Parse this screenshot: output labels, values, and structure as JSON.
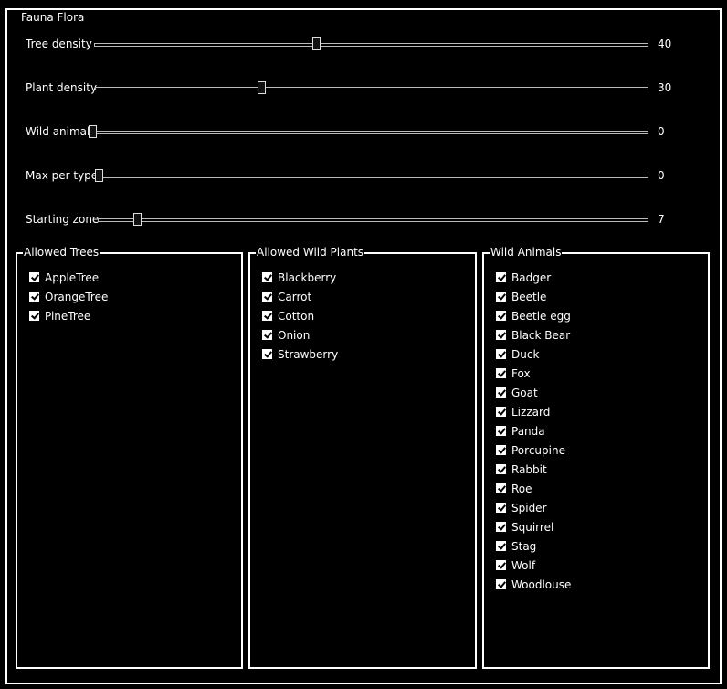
{
  "tabs": [
    "Fauna",
    "Flora"
  ],
  "tabs_label": "Fauna  Flora",
  "sliders": [
    {
      "label": "Tree density",
      "value": 40,
      "min": 0,
      "max": 100
    },
    {
      "label": "Plant density",
      "value": 30,
      "min": 0,
      "max": 100
    },
    {
      "label": "Wild animals",
      "value": 0,
      "min": 0,
      "max": 100
    },
    {
      "label": "Max per type",
      "value": 0,
      "min": 0,
      "max": 100
    },
    {
      "label": "Starting zone",
      "value": 7,
      "min": 0,
      "max": 100
    }
  ],
  "groups": [
    {
      "title": "Allowed Trees",
      "items": [
        {
          "label": "AppleTree",
          "checked": true
        },
        {
          "label": "OrangeTree",
          "checked": true
        },
        {
          "label": "PineTree",
          "checked": true
        }
      ]
    },
    {
      "title": "Allowed Wild Plants",
      "items": [
        {
          "label": "Blackberry",
          "checked": true
        },
        {
          "label": "Carrot",
          "checked": true
        },
        {
          "label": "Cotton",
          "checked": true
        },
        {
          "label": "Onion",
          "checked": true
        },
        {
          "label": "Strawberry",
          "checked": true
        }
      ]
    },
    {
      "title": "Wild Animals",
      "items": [
        {
          "label": "Badger",
          "checked": true
        },
        {
          "label": "Beetle",
          "checked": true
        },
        {
          "label": "Beetle egg",
          "checked": true
        },
        {
          "label": "Black Bear",
          "checked": true
        },
        {
          "label": "Duck",
          "checked": true
        },
        {
          "label": "Fox",
          "checked": true
        },
        {
          "label": "Goat",
          "checked": true
        },
        {
          "label": "Lizzard",
          "checked": true
        },
        {
          "label": "Panda",
          "checked": true
        },
        {
          "label": "Porcupine",
          "checked": true
        },
        {
          "label": "Rabbit",
          "checked": true
        },
        {
          "label": "Roe",
          "checked": true
        },
        {
          "label": "Spider",
          "checked": true
        },
        {
          "label": "Squirrel",
          "checked": true
        },
        {
          "label": "Stag",
          "checked": true
        },
        {
          "label": "Wolf",
          "checked": true
        },
        {
          "label": "Woodlouse",
          "checked": true
        }
      ]
    }
  ]
}
